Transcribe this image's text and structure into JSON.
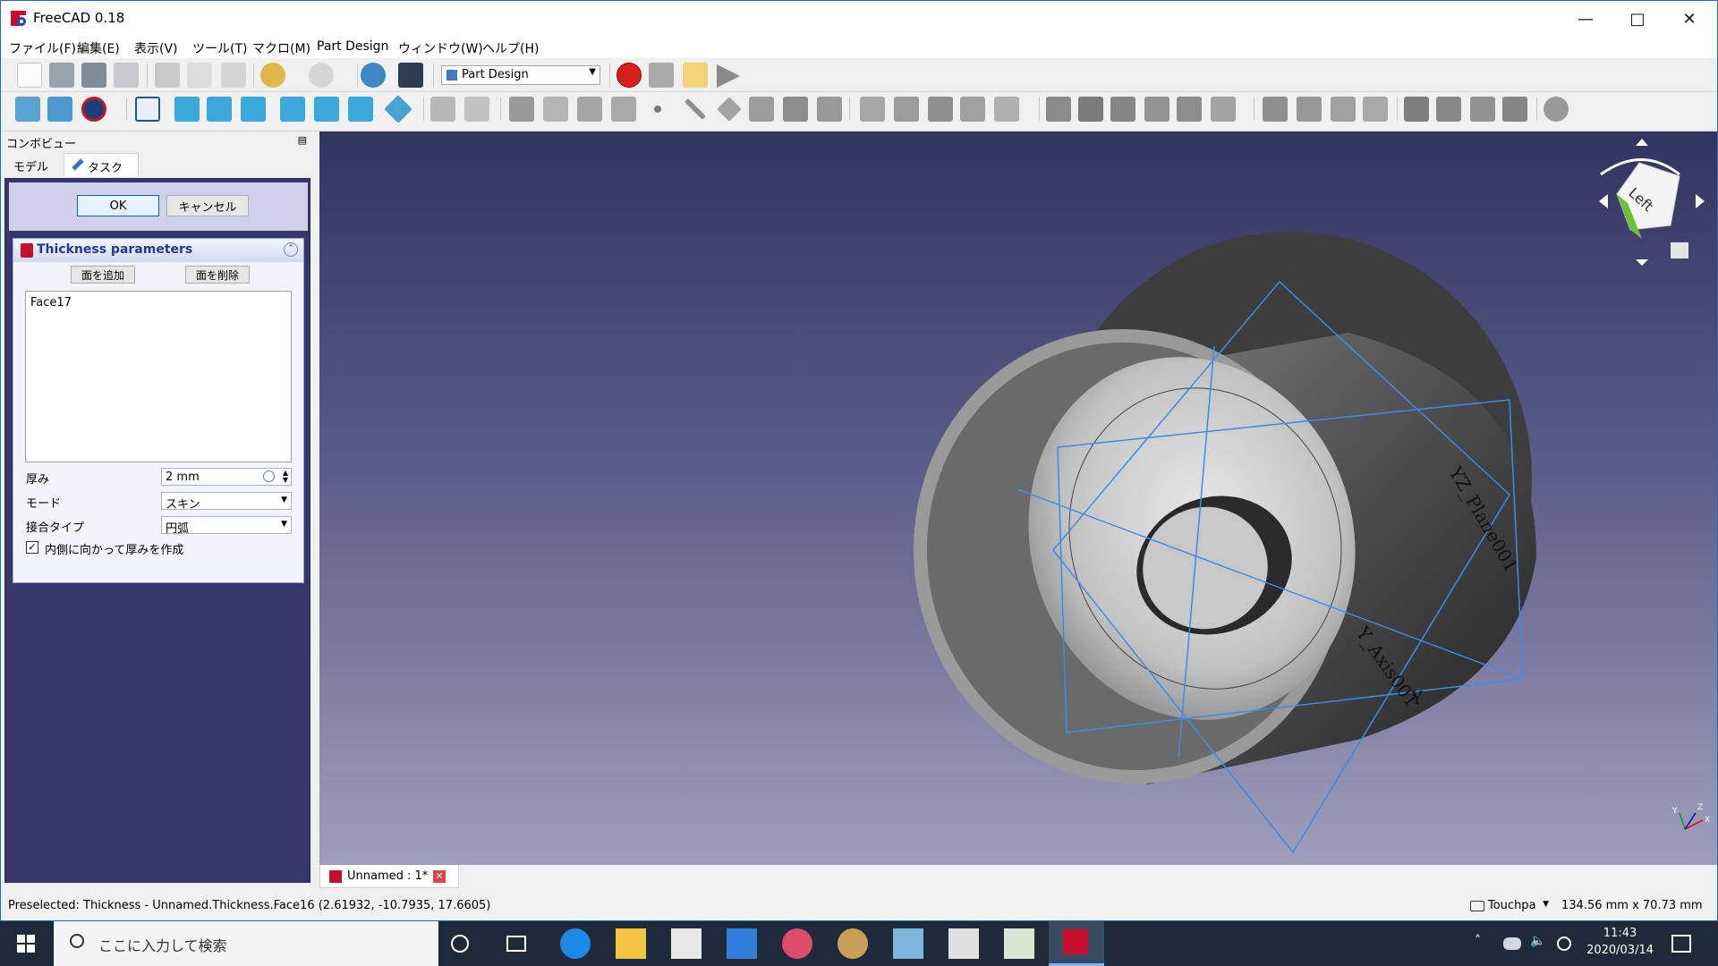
{
  "window": {
    "title": "FreeCAD 0.18"
  },
  "menu": {
    "items": [
      "ファイル(F)",
      "編集(E)",
      "表示(V)",
      "ツール(T)",
      "マクロ(M)",
      "Part Design",
      "ウィンドウ(W)",
      "ヘルプ(H)"
    ]
  },
  "toolbar": {
    "workbench": "Part Design"
  },
  "combo": {
    "header": "コンボビュー",
    "tabs": [
      "モデル",
      "タスク"
    ]
  },
  "task": {
    "ok_label": "OK",
    "cancel_label": "キャンセル",
    "params_title": "Thickness parameters",
    "add_face_label": "面を追加",
    "remove_face_label": "面を削除",
    "faces": [
      "Face17"
    ],
    "thickness_label": "厚み",
    "thickness_value": "2 mm",
    "mode_label": "モード",
    "mode_value": "スキン",
    "join_label": "接合タイプ",
    "join_value": "円弧",
    "inward_label": "内側に向かって厚みを作成",
    "inward_checked": true
  },
  "viewport": {
    "navcube_face": "Left",
    "labels": {
      "plane": "YZ_Plane001",
      "axis": "Y_Axis001",
      "y": "Y",
      "axis_x": "X",
      "axis_y": "Y",
      "axis_z": "Z"
    }
  },
  "document_tab": {
    "label": "Unnamed : 1*"
  },
  "status": {
    "text": "Preselected: Thickness - Unnamed.Thickness.Face16 (2.61932, -10.7935, 17.6605)",
    "nav_style": "Touchpa",
    "dimensions": "134.56 mm x 70.73 mm"
  },
  "taskbar": {
    "search_placeholder": "ここに入力して検索",
    "time": "11:43",
    "date": "2020/03/14"
  },
  "colors": {
    "accent": "#1f3a98",
    "selection": "#3d8be8",
    "record": "#d81e1e"
  }
}
